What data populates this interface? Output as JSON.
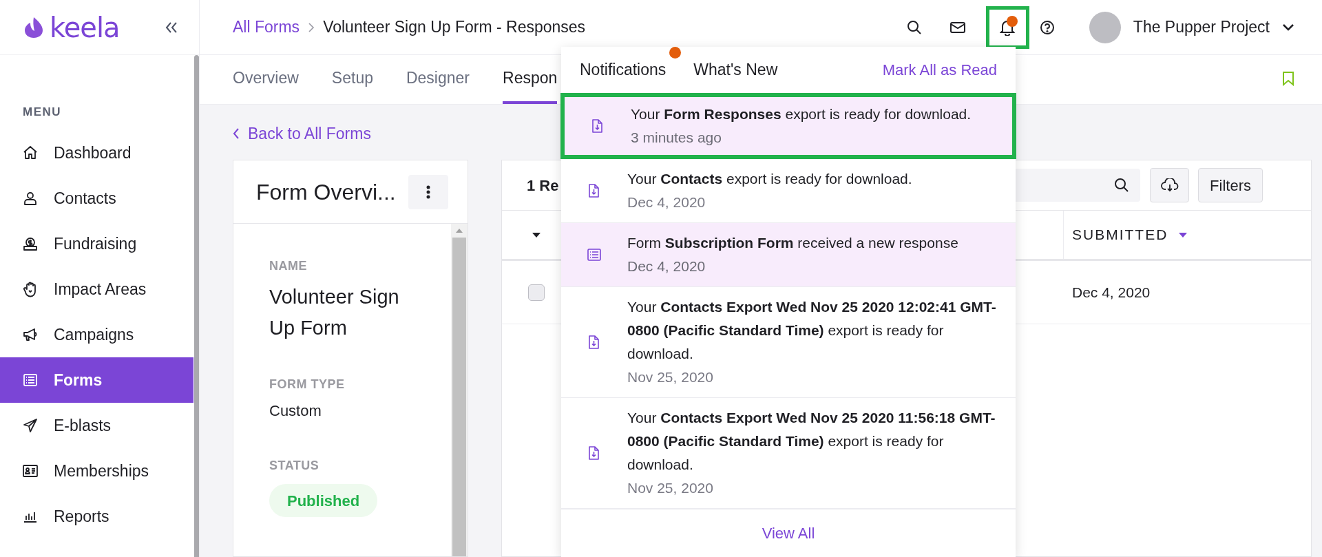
{
  "sidebar": {
    "logo": "keela",
    "menu_heading": "MENU",
    "items": [
      {
        "label": "Dashboard",
        "kind": "home",
        "selected": false
      },
      {
        "label": "Contacts",
        "kind": "user",
        "selected": false
      },
      {
        "label": "Fundraising",
        "kind": "donation",
        "selected": false
      },
      {
        "label": "Impact Areas",
        "kind": "hand",
        "selected": false
      },
      {
        "label": "Campaigns",
        "kind": "megaphone",
        "selected": false
      },
      {
        "label": "Forms",
        "kind": "list",
        "selected": true
      },
      {
        "label": "E-blasts",
        "kind": "send",
        "selected": false
      },
      {
        "label": "Memberships",
        "kind": "card",
        "selected": false
      },
      {
        "label": "Reports",
        "kind": "chart",
        "selected": false
      }
    ]
  },
  "header": {
    "breadcrumb_link": "All Forms",
    "page_title": "Volunteer Sign Up Form - Responses",
    "account_name": "The Pupper Project",
    "bell_has_dot": true,
    "bell_annotated": true
  },
  "tabs": [
    {
      "label": "Overview",
      "selected": false
    },
    {
      "label": "Setup",
      "selected": false
    },
    {
      "label": "Designer",
      "selected": false
    },
    {
      "label": "Respon",
      "selected": true
    }
  ],
  "back_link": "Back to All Forms",
  "overview": {
    "title": "Form Overvi...",
    "fields": [
      {
        "label": "NAME",
        "value": "Volunteer Sign Up Form",
        "kind": "title"
      },
      {
        "label": "FORM TYPE",
        "value": "Custom",
        "kind": "text"
      },
      {
        "label": "STATUS",
        "value": "Published",
        "kind": "badge"
      }
    ]
  },
  "responses": {
    "count_text": "1 Re",
    "filters_button": "Filters",
    "columns": [
      "SUBMITTED"
    ],
    "rows": [
      {
        "checked": false,
        "submitted": "Dec 4, 2020"
      }
    ]
  },
  "notifications": {
    "tabs": [
      {
        "label": "Notifications",
        "has_dot": true
      },
      {
        "label": "What's New",
        "has_dot": false
      }
    ],
    "mark_all": "Mark All as Read",
    "view_all": "View All",
    "items": [
      {
        "kind": "export",
        "text": "Your **Form Responses** export is ready for download.",
        "time": "3 minutes ago",
        "unread": true,
        "annotated": true
      },
      {
        "kind": "export",
        "text": "Your **Contacts** export is ready for download.",
        "time": "Dec 4, 2020",
        "unread": false,
        "annotated": false
      },
      {
        "kind": "form",
        "text": "Form **Subscription Form** received a new response",
        "time": "Dec 4, 2020",
        "unread": true,
        "annotated": false
      },
      {
        "kind": "export",
        "text": "Your **Contacts Export Wed Nov 25 2020 12:02:41 GMT-0800 (Pacific Standard Time)** export is ready for download.",
        "time": "Nov 25, 2020",
        "unread": false,
        "annotated": false
      },
      {
        "kind": "export",
        "text": "Your **Contacts Export Wed Nov 25 2020 11:56:18 GMT-0800 (Pacific Standard Time)** export is ready for download.",
        "time": "Nov 25, 2020",
        "unread": false,
        "annotated": false
      }
    ]
  }
}
